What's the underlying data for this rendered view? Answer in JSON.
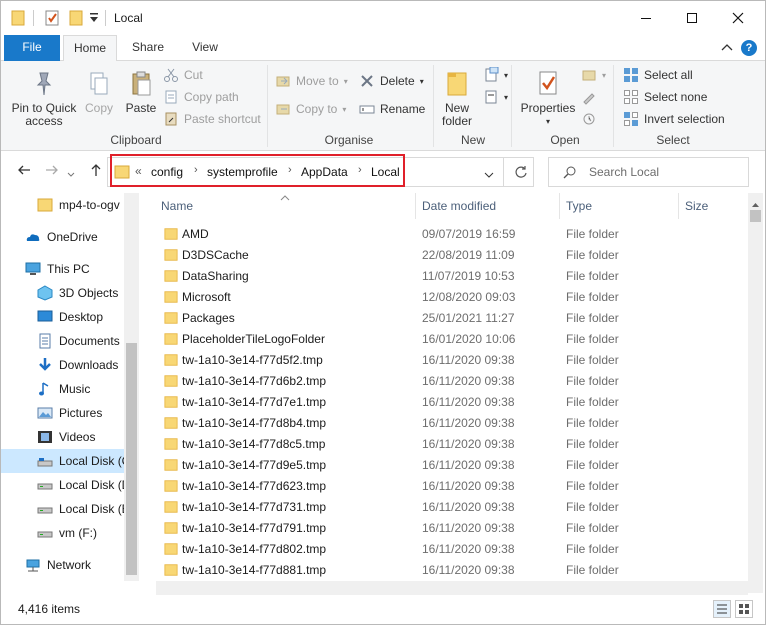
{
  "window": {
    "title": "Local",
    "minimize_icon": "minimize-icon",
    "maximize_icon": "maximize-icon",
    "close_icon": "close-icon"
  },
  "ribbon_tabs": [
    "File",
    "Home",
    "Share",
    "View"
  ],
  "ribbon": {
    "clipboard": {
      "label": "Clipboard",
      "pin": "Pin to Quick access",
      "pin_line1": "Pin to Quick",
      "pin_line2": "access",
      "copy": "Copy",
      "paste": "Paste",
      "cut": "Cut",
      "copy_path": "Copy path",
      "paste_shortcut": "Paste shortcut"
    },
    "organise": {
      "label": "Organise",
      "move_to": "Move to",
      "copy_to": "Copy to",
      "delete": "Delete",
      "rename": "Rename"
    },
    "new": {
      "label": "New",
      "new_folder_line1": "New",
      "new_folder_line2": "folder"
    },
    "open": {
      "label": "Open",
      "properties": "Properties"
    },
    "select": {
      "label": "Select",
      "select_all": "Select all",
      "select_none": "Select none",
      "invert": "Invert selection"
    }
  },
  "address": {
    "overflow": "«",
    "crumbs": [
      "config",
      "systemprofile",
      "AppData",
      "Local"
    ],
    "search_placeholder": "Search Local"
  },
  "nav_pane": [
    {
      "label": "mp4-to-ogv",
      "icon": "folder-icon"
    },
    {
      "label": "OneDrive",
      "icon": "onedrive-icon"
    },
    {
      "label": "This PC",
      "icon": "pc-icon"
    },
    {
      "label": "3D Objects",
      "icon": "3d-objects-icon"
    },
    {
      "label": "Desktop",
      "icon": "desktop-icon"
    },
    {
      "label": "Documents",
      "icon": "documents-icon"
    },
    {
      "label": "Downloads",
      "icon": "downloads-icon"
    },
    {
      "label": "Music",
      "icon": "music-icon"
    },
    {
      "label": "Pictures",
      "icon": "pictures-icon"
    },
    {
      "label": "Videos",
      "icon": "videos-icon"
    },
    {
      "label": "Local Disk (C",
      "icon": "disk-icon"
    },
    {
      "label": "Local Disk (D",
      "icon": "disk-icon"
    },
    {
      "label": "Local Disk (E",
      "icon": "disk-icon"
    },
    {
      "label": "vm (F:)",
      "icon": "disk-icon"
    },
    {
      "label": "Network",
      "icon": "network-icon"
    }
  ],
  "columns": {
    "name": "Name",
    "date": "Date modified",
    "type": "Type",
    "size": "Size"
  },
  "files": [
    {
      "name": "AMD",
      "date": "09/07/2019 16:59",
      "type": "File folder"
    },
    {
      "name": "D3DSCache",
      "date": "22/08/2019 11:09",
      "type": "File folder"
    },
    {
      "name": "DataSharing",
      "date": "11/07/2019 10:53",
      "type": "File folder"
    },
    {
      "name": "Microsoft",
      "date": "12/08/2020 09:03",
      "type": "File folder"
    },
    {
      "name": "Packages",
      "date": "25/01/2021 11:27",
      "type": "File folder"
    },
    {
      "name": "PlaceholderTileLogoFolder",
      "date": "16/01/2020 10:06",
      "type": "File folder"
    },
    {
      "name": "tw-1a10-3e14-f77d5f2.tmp",
      "date": "16/11/2020 09:38",
      "type": "File folder"
    },
    {
      "name": "tw-1a10-3e14-f77d6b2.tmp",
      "date": "16/11/2020 09:38",
      "type": "File folder"
    },
    {
      "name": "tw-1a10-3e14-f77d7e1.tmp",
      "date": "16/11/2020 09:38",
      "type": "File folder"
    },
    {
      "name": "tw-1a10-3e14-f77d8b4.tmp",
      "date": "16/11/2020 09:38",
      "type": "File folder"
    },
    {
      "name": "tw-1a10-3e14-f77d8c5.tmp",
      "date": "16/11/2020 09:38",
      "type": "File folder"
    },
    {
      "name": "tw-1a10-3e14-f77d9e5.tmp",
      "date": "16/11/2020 09:38",
      "type": "File folder"
    },
    {
      "name": "tw-1a10-3e14-f77d623.tmp",
      "date": "16/11/2020 09:38",
      "type": "File folder"
    },
    {
      "name": "tw-1a10-3e14-f77d731.tmp",
      "date": "16/11/2020 09:38",
      "type": "File folder"
    },
    {
      "name": "tw-1a10-3e14-f77d791.tmp",
      "date": "16/11/2020 09:38",
      "type": "File folder"
    },
    {
      "name": "tw-1a10-3e14-f77d802.tmp",
      "date": "16/11/2020 09:38",
      "type": "File folder"
    },
    {
      "name": "tw-1a10-3e14-f77d881.tmp",
      "date": "16/11/2020 09:38",
      "type": "File folder"
    }
  ],
  "status": {
    "item_count": "4,416 items"
  },
  "colors": {
    "accent": "#1979ca",
    "folder": "#f8d775",
    "folder_dark": "#e7b542",
    "highlight_box": "#e0202a",
    "selected_nav": "#cce8ff"
  }
}
